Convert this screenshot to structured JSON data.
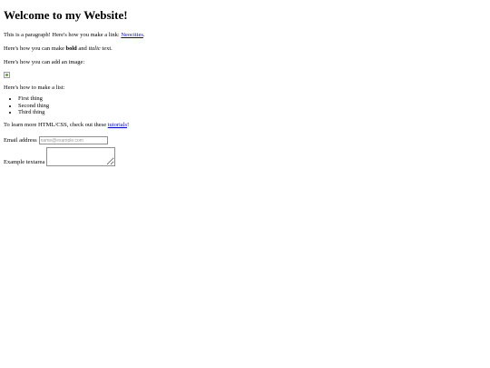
{
  "heading": "Welcome to my Website!",
  "intro": {
    "text_before": "This is a paragraph! Here's how you make a link: ",
    "link_label": "Neocities",
    "text_after": "."
  },
  "formatting": {
    "text_before": "Here's how you can make ",
    "bold_label": "bold",
    "text_middle": " and ",
    "italic_label": "italic",
    "text_after": " text."
  },
  "image_paragraph": "Here's how you can add an image:",
  "list_paragraph": "Here's how to make a list:",
  "list_items": [
    "First thing",
    "Second thing",
    "Third thing"
  ],
  "tutorials": {
    "text_before": "To learn more HTML/CSS, check out these ",
    "link_label": "tutorials",
    "text_after": "!"
  },
  "form": {
    "email_label": "Email address",
    "email_placeholder": "name@example.com",
    "email_value": "",
    "textarea_label": "Example textarea",
    "textarea_value": ""
  },
  "colors": {
    "link": "#0000ee",
    "text": "#000000",
    "background": "#ffffff"
  }
}
